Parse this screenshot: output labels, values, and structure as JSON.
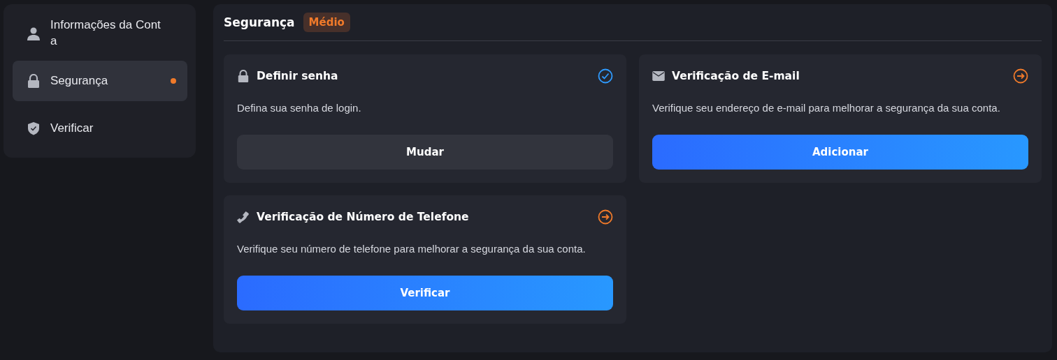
{
  "sidebar": {
    "items": [
      {
        "label": "Informações da Conta",
        "selected": false,
        "dot": false
      },
      {
        "label": "Segurança",
        "selected": true,
        "dot": true
      },
      {
        "label": "Verificar",
        "selected": false,
        "dot": false
      }
    ]
  },
  "main": {
    "title": "Segurança",
    "badge": "Médio",
    "cards": [
      {
        "title": "Definir senha",
        "verified": true,
        "description": "Defina sua senha de login.",
        "button": {
          "label": "Mudar",
          "kind": "secondary"
        }
      },
      {
        "title": "Verificação de E-mail",
        "verified": false,
        "description": "Verifique seu endereço de e-mail para melhorar a segurança da sua conta.",
        "button": {
          "label": "Adicionar",
          "kind": "primary"
        }
      },
      {
        "title": "Verificação de Número de Telefone",
        "verified": false,
        "description": "Verifique seu número de telefone para melhorar a segurança da sua conta.",
        "button": {
          "label": "Verificar",
          "kind": "primary"
        }
      }
    ]
  }
}
